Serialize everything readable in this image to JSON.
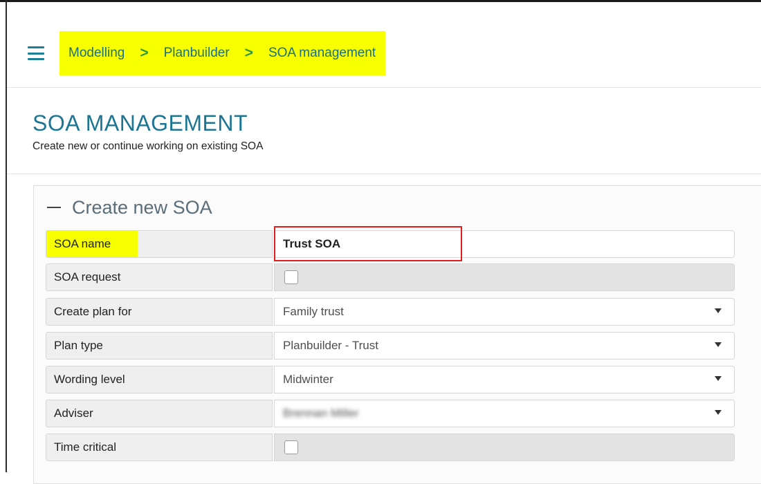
{
  "breadcrumb": {
    "items": [
      "Modelling",
      "Planbuilder",
      "SOA management"
    ],
    "separator": ">"
  },
  "page": {
    "title": "SOA MANAGEMENT",
    "subtitle": "Create new or continue working on existing SOA"
  },
  "panel": {
    "title": "Create new SOA"
  },
  "form": {
    "soa_name": {
      "label": "SOA name",
      "value": "Trust SOA"
    },
    "soa_request": {
      "label": "SOA request",
      "checked": false
    },
    "create_plan_for": {
      "label": "Create plan for",
      "value": "Family trust"
    },
    "plan_type": {
      "label": "Plan type",
      "value": "Planbuilder - Trust"
    },
    "wording_level": {
      "label": "Wording level",
      "value": "Midwinter"
    },
    "adviser": {
      "label": "Adviser",
      "value": "Brennan Miller"
    },
    "time_critical": {
      "label": "Time critical",
      "checked": false
    }
  },
  "colors": {
    "accent": "#1d7593",
    "highlight": "#f7ff00",
    "chevron": "#2f9a3a",
    "annotation_box": "#e21d1d"
  },
  "icons": {
    "menu": "hamburger-icon",
    "chevron": "chevron-right-icon",
    "collapse": "minus-icon",
    "dropdown": "caret-down-icon"
  }
}
